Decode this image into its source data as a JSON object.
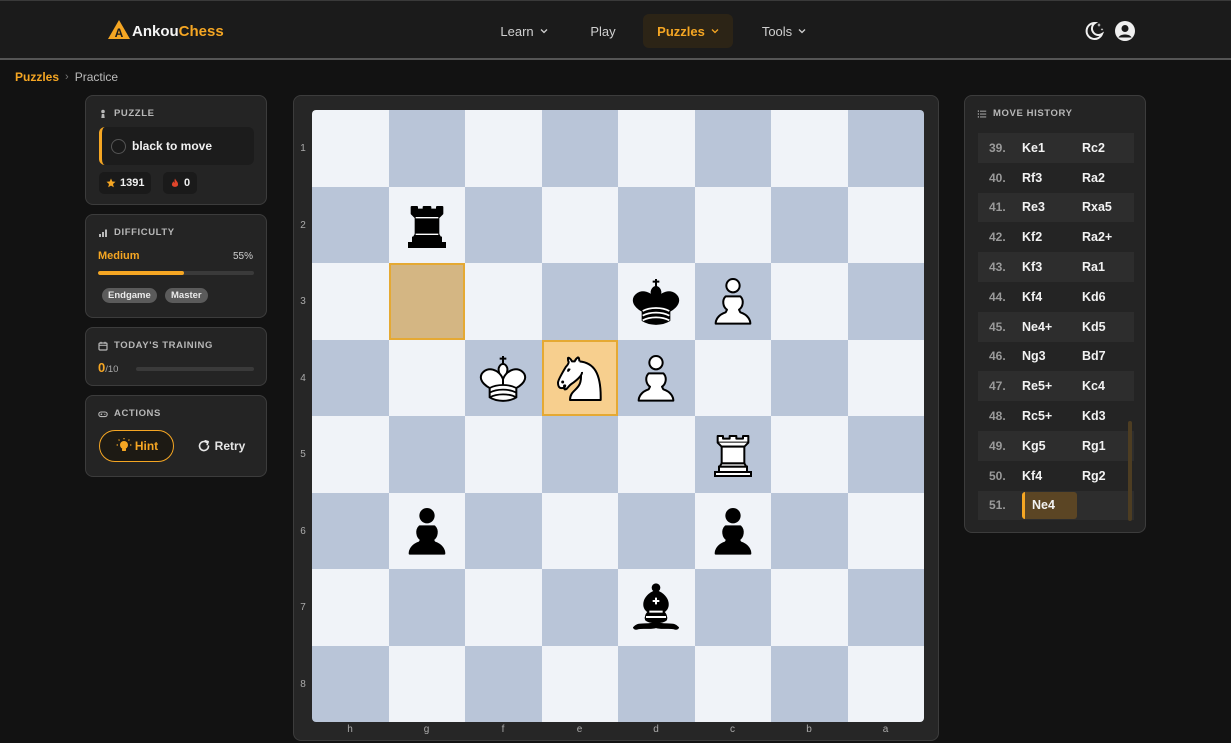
{
  "brand": {
    "part1": "Ankou",
    "part2": "Chess",
    "logo_letter": "A",
    "accent": "#f5a623"
  },
  "nav": {
    "learn": "Learn",
    "play": "Play",
    "puzzles": "Puzzles",
    "tools": "Tools"
  },
  "breadcrumb": {
    "root": "Puzzles",
    "current": "Practice"
  },
  "puzzle": {
    "title": "PUZZLE",
    "to_move": "black to move",
    "rating": "1391",
    "streak": "0"
  },
  "difficulty": {
    "title": "DIFFICULTY",
    "level": "Medium",
    "percent_label": "55%",
    "percent": 55,
    "tags": [
      "Endgame",
      "Master"
    ]
  },
  "training": {
    "title": "TODAY'S TRAINING",
    "done": "0",
    "total": "/10",
    "progress": 0
  },
  "actions": {
    "title": "ACTIONS",
    "hint": "Hint",
    "retry": "Retry"
  },
  "board": {
    "rank_labels": [
      "1",
      "2",
      "3",
      "4",
      "5",
      "6",
      "7",
      "8"
    ],
    "file_labels": [
      "h",
      "g",
      "f",
      "e",
      "d",
      "c",
      "b",
      "a"
    ],
    "squares": [
      [
        "",
        "",
        "",
        "",
        "",
        "",
        "",
        ""
      ],
      [
        "",
        "bR",
        "",
        "",
        "",
        "",
        "",
        ""
      ],
      [
        "",
        "",
        "",
        "",
        "bK",
        "wP",
        "",
        ""
      ],
      [
        "",
        "",
        "wK",
        "wN",
        "wP",
        "",
        "",
        ""
      ],
      [
        "",
        "",
        "",
        "",
        "",
        "wR",
        "",
        ""
      ],
      [
        "",
        "bP",
        "",
        "",
        "",
        "bP",
        "",
        ""
      ],
      [
        "",
        "",
        "",
        "",
        "bB",
        "",
        "",
        ""
      ],
      [
        "",
        "",
        "",
        "",
        "",
        "",
        "",
        ""
      ]
    ],
    "highlight_from": [
      2,
      1
    ],
    "highlight_to": [
      3,
      3
    ],
    "light_color": "#f0f3f8",
    "dark_color": "#b9c5d8"
  },
  "history": {
    "title": "MOVE HISTORY",
    "moves": [
      {
        "num": "39.",
        "white": "Ke1",
        "black": "Rc2"
      },
      {
        "num": "40.",
        "white": "Rf3",
        "black": "Ra2"
      },
      {
        "num": "41.",
        "white": "Re3",
        "black": "Rxa5"
      },
      {
        "num": "42.",
        "white": "Kf2",
        "black": "Ra2+"
      },
      {
        "num": "43.",
        "white": "Kf3",
        "black": "Ra1"
      },
      {
        "num": "44.",
        "white": "Kf4",
        "black": "Kd6"
      },
      {
        "num": "45.",
        "white": "Ne4+",
        "black": "Kd5"
      },
      {
        "num": "46.",
        "white": "Ng3",
        "black": "Bd7"
      },
      {
        "num": "47.",
        "white": "Re5+",
        "black": "Kc4"
      },
      {
        "num": "48.",
        "white": "Rc5+",
        "black": "Kd3"
      },
      {
        "num": "49.",
        "white": "Kg5",
        "black": "Rg1"
      },
      {
        "num": "50.",
        "white": "Kf4",
        "black": "Rg2"
      },
      {
        "num": "51.",
        "white": "Ne4",
        "black": ""
      }
    ]
  }
}
